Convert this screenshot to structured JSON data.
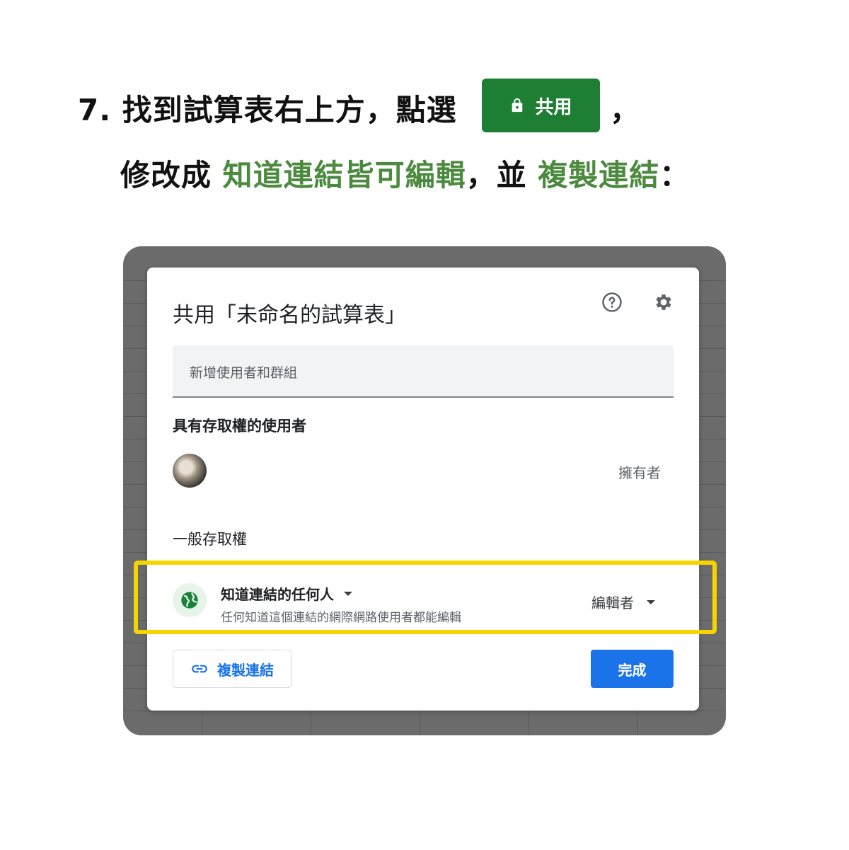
{
  "instruction": {
    "line1_prefix": "7. 找到試算表右上方，點選",
    "share_pill_label": "共用",
    "line1_suffix": "，",
    "line2_part1": "修改成 ",
    "line2_highlight1": "知道連結皆可編輯",
    "line2_part2": "，並 ",
    "line2_highlight2": "複製連結",
    "line2_part3": "："
  },
  "dialog": {
    "title": "共用「未命名的試算表」",
    "help_icon": "help-icon",
    "settings_icon": "gear-icon",
    "add_people_placeholder": "新增使用者和群組",
    "people_section_title": "具有存取權的使用者",
    "owner_role": "擁有者",
    "general_access_title": "一般存取權",
    "access_option": "知道連結的任何人",
    "access_description": "任何知道這個連結的網際網路使用者都能編輯",
    "access_role": "編輯者",
    "copy_link_label": "複製連結",
    "done_label": "完成"
  },
  "colors": {
    "share_pill": "#1e7e34",
    "instruction_green": "#4c8b3f",
    "highlight_border": "#f5d400",
    "primary_blue": "#1a73e8",
    "globe_green": "#188038"
  }
}
